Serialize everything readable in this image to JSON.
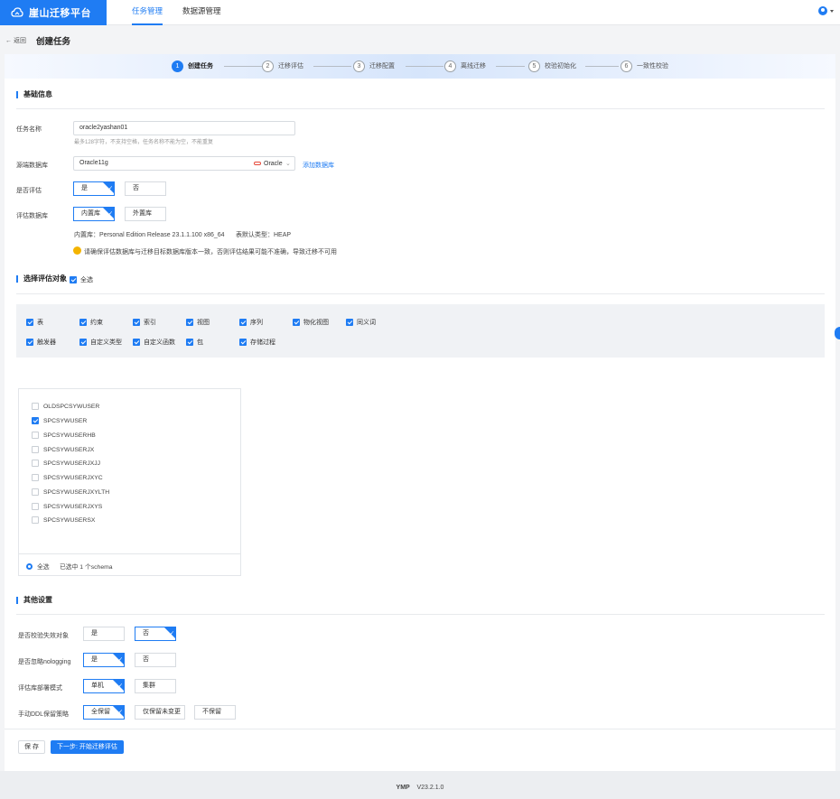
{
  "header": {
    "app_name": "崖山迁移平台",
    "nav": [
      "任务管理",
      "数据源管理"
    ],
    "avatar_letter": ""
  },
  "page": {
    "back": "返回",
    "title": "创建任务"
  },
  "steps": [
    {
      "num": "1",
      "label": "创建任务"
    },
    {
      "num": "2",
      "label": "迁移评估"
    },
    {
      "num": "3",
      "label": "迁移配置"
    },
    {
      "num": "4",
      "label": "离线迁移"
    },
    {
      "num": "5",
      "label": "校验初始化"
    },
    {
      "num": "6",
      "label": "一致性校验"
    }
  ],
  "basic": {
    "section_title": "基础信息",
    "task_name_label": "任务名称",
    "task_name_value": "oracle2yashan01",
    "task_name_hint": "最多128字符，不支持空格，任务名称不能为空，不能重复",
    "source_db_label": "源端数据库",
    "source_db_value": "Oracle11g",
    "source_db_type": "Oracle",
    "add_db_link": "添加数据库",
    "evaluate_label": "是否评估",
    "evaluate_yes": "是",
    "evaluate_no": "否",
    "eval_db_label": "评估数据库",
    "eval_db_builtin": "内置库",
    "eval_db_external": "外置库",
    "builtin_info": "内置库：Personal Edition Release 23.1.1.100 x86_64",
    "table_type_info": "表默认类型：HEAP",
    "warning": "请确保评估数据库与迁移目标数据库版本一致，否则评估结果可能不准确，导致迁移不可用"
  },
  "objects": {
    "section_title": "选择评估对象",
    "select_all": "全选",
    "row1": [
      "表",
      "约束",
      "索引",
      "视图",
      "序列",
      "物化视图",
      "同义词"
    ],
    "row2": [
      "触发器",
      "自定义类型",
      "自定义函数",
      "包",
      "存储过程"
    ]
  },
  "schemas": {
    "items": [
      "OLDSPCSYWUSER",
      "SPCSYWUSER",
      "SPCSYWUSERHB",
      "SPCSYWUSERJX",
      "SPCSYWUSERJXJJ",
      "SPCSYWUSERJXYC",
      "SPCSYWUSERJXYLTH",
      "SPCSYWUSERJXYS",
      "SPCSYWUSERSX"
    ],
    "checked_index": 1,
    "footer_all": "全选",
    "footer_count": "已选中 1 个schema"
  },
  "other": {
    "section_title": "其他设置",
    "verify_invalid_label": "是否校验失效对象",
    "ignore_nologging_label": "是否忽略nologging",
    "deploy_mode_label": "评估库部署模式",
    "ddl_strategy_label": "手动DDL保留策略",
    "yes": "是",
    "no": "否",
    "standalone": "单机",
    "cluster": "集群",
    "keep_all": "全保留",
    "keep_unchanged": "仅保留未变更",
    "keep_none": "不保留"
  },
  "actions": {
    "save": "保 存",
    "next": "下一步: 开始迁移评估"
  },
  "footer": {
    "product": "YMP",
    "version": "V23.2.1.0"
  },
  "colors": {
    "accent": "#1f7cf3",
    "warning": "#f4b400"
  }
}
